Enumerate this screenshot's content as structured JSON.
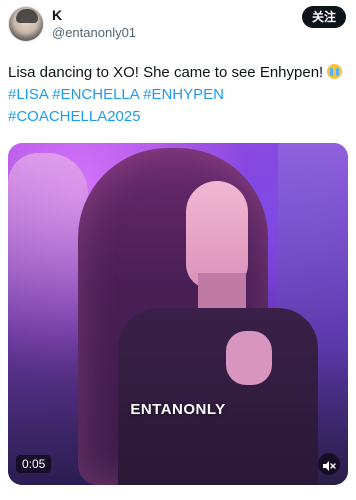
{
  "author": {
    "display_name": "K",
    "handle": "@entanonly01",
    "avatar_icon": "profile-photo"
  },
  "follow_button": {
    "label": "关注"
  },
  "tweet": {
    "text": "Lisa dancing to XO! She came to see Enhypen!",
    "emoji": "loudly-crying-face",
    "hashtags": [
      "#LISA",
      "#ENCHELLA",
      "#ENHYPEN",
      "#COACHELLA2025"
    ],
    "hashtag_color": "#1d9bf0"
  },
  "video": {
    "watermark": "ENTANONLY",
    "timestamp": "0:05",
    "mute_icon": "speaker-muted-icon"
  }
}
